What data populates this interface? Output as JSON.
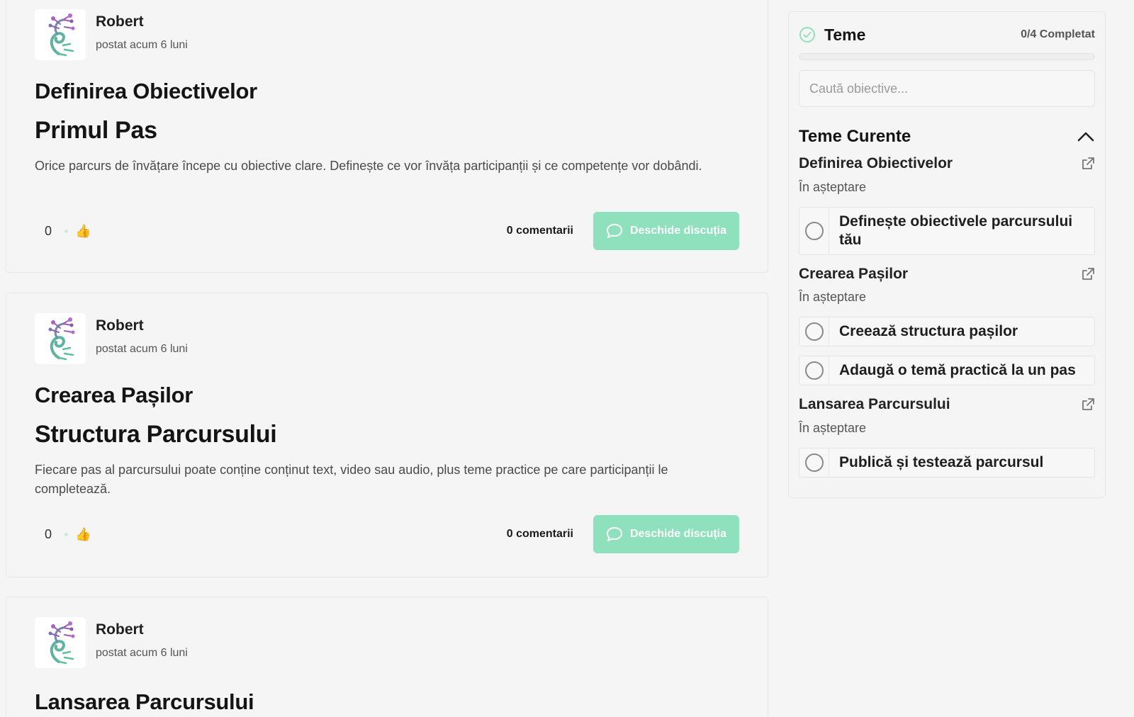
{
  "posts": [
    {
      "author": "Robert",
      "time": "postat acum 6 luni",
      "title": "Definirea Obiectivelor",
      "subtitle": "Primul Pas",
      "body": "Orice parcurs de învățare începe cu obiective clare. Definește ce vor învăța participanții și ce competențe vor dobândi.",
      "likes": "0",
      "comments": "0 comentarii",
      "button": "Deschide discuția"
    },
    {
      "author": "Robert",
      "time": "postat acum 6 luni",
      "title": "Crearea Pașilor",
      "subtitle": "Structura Parcursului",
      "body": "Fiecare pas al parcursului poate conține conținut text, video sau audio, plus teme practice pe care participanții le completează.",
      "likes": "0",
      "comments": "0 comentarii",
      "button": "Deschide discuția"
    },
    {
      "author": "Robert",
      "time": "postat acum 6 luni",
      "title": "Lansarea Parcursului"
    }
  ],
  "sidebar": {
    "title": "Teme",
    "progress_text": "0/4 Completat",
    "progress_fraction": 0,
    "search_placeholder": "Caută obiective...",
    "section_title": "Teme Curente",
    "themes": [
      {
        "name": "Definirea Obiectivelor",
        "status": "În așteptare",
        "tasks": [
          "Definește obiectivele parcursului tău"
        ]
      },
      {
        "name": "Crearea Pașilor",
        "status": "În așteptare",
        "tasks": [
          "Creează structura pașilor",
          "Adaugă o temă practică la un pas"
        ]
      },
      {
        "name": "Lansarea Parcursului",
        "status": "În așteptare",
        "tasks": [
          "Publică și testează parcursul"
        ]
      }
    ]
  },
  "colors": {
    "accent": "#8fe0bd",
    "background": "#f5f5f5"
  },
  "icons": {
    "avatar": "tree-logo-icon",
    "like": "thumbs-up-icon",
    "chat": "chat-bubble-icon",
    "check": "check-circle-icon",
    "collapse": "chevron-up-icon",
    "open": "external-link-icon"
  }
}
